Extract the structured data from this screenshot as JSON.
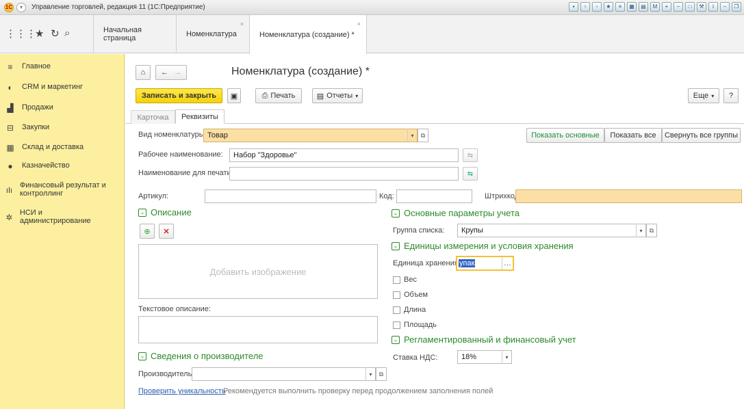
{
  "window": {
    "title": "Управление торговлей, редакция 11 (1С:Предприятие)",
    "logo_text": "1С"
  },
  "tabs": [
    {
      "label": "Начальная страница"
    },
    {
      "label": "Номенклатура"
    },
    {
      "label": "Номенклатура (создание) *"
    }
  ],
  "sidebar": {
    "items": [
      {
        "label": "Главное",
        "icon": "menu-lines-icon"
      },
      {
        "label": "CRM и маркетинг",
        "icon": "crm-icon"
      },
      {
        "label": "Продажи",
        "icon": "sales-bag-icon"
      },
      {
        "label": "Закупки",
        "icon": "cart-icon"
      },
      {
        "label": "Склад и доставка",
        "icon": "warehouse-icon"
      },
      {
        "label": "Казначейство",
        "icon": "treasury-icon"
      },
      {
        "label": "Финансовый результат и контроллинг",
        "icon": "bar-chart-icon"
      },
      {
        "label": "НСИ и администрирование",
        "icon": "gear-icon"
      }
    ]
  },
  "form": {
    "title": "Номенклатура (создание) *",
    "save_close": "Записать и закрыть",
    "print": "Печать",
    "reports": "Отчеты",
    "more": "Еще",
    "help": "?",
    "subtabs": [
      "Карточка",
      "Реквизиты"
    ],
    "kind_label": "Вид номенклатуры:",
    "kind_value": "Товар",
    "show_main": "Показать основные",
    "show_all": "Показать все",
    "collapse_all": "Свернуть все группы",
    "work_name_label": "Рабочее наименование:",
    "work_name_value": "Набор \"Здоровье\"",
    "print_name_label": "Наименование для печати:",
    "print_name_value": "",
    "article_label": "Артикул:",
    "code_label": "Код:",
    "barcode_label": "Штрихкод:",
    "desc_section": "Описание",
    "add_image": "Добавить изображение",
    "text_desc_label": "Текстовое описание:",
    "maker_section": "Сведения о производителе",
    "maker_label": "Производитель:",
    "check_unique": "Проверить уникальность",
    "check_hint": "Рекомендуется выполнить проверку перед продолжением заполнения полей",
    "params_section": "Основные параметры учета",
    "group_label": "Группа списка:",
    "group_value": "Крупы",
    "units_section": "Единицы измерения и условия хранения",
    "unit_label": "Единица хранения:",
    "unit_value": "упак",
    "weight": "Вес",
    "volume": "Объем",
    "length": "Длина",
    "area": "Площадь",
    "reg_section": "Регламентированный и финансовый учет",
    "vat_label": "Ставка НДС:",
    "vat_value": "18%"
  }
}
